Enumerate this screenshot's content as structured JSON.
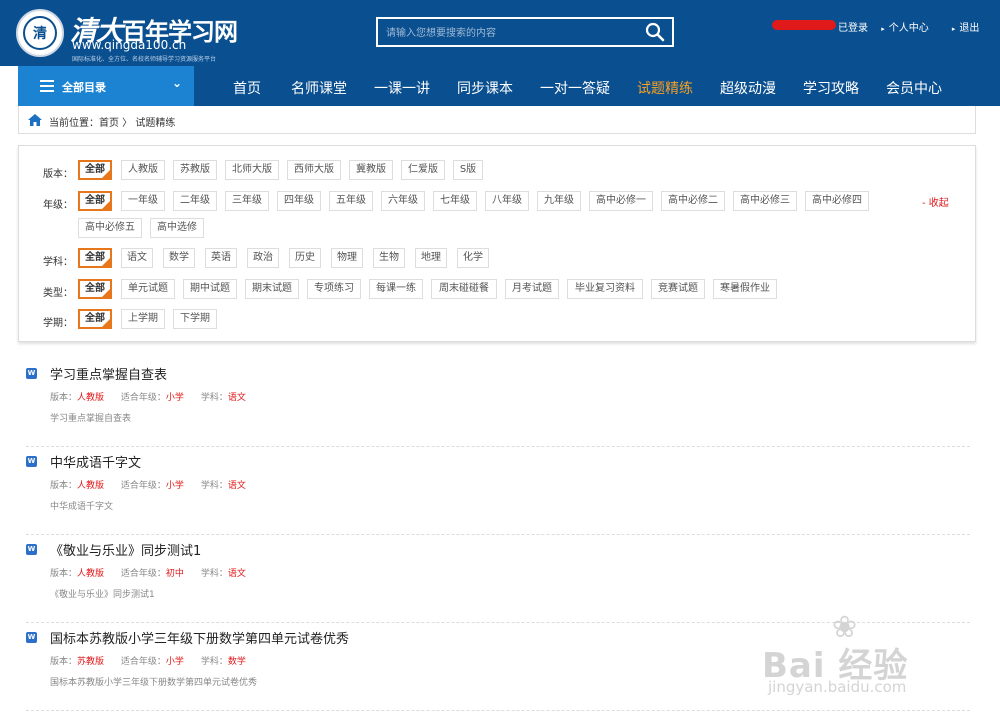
{
  "header": {
    "brand_seal": "清",
    "brand_name_part1": "清大",
    "brand_name_part2": "百年学习网",
    "brand_url": "www.qingda100.cn",
    "brand_slogan": "国际标准化、全方位、名校名师辅导学习资源服务平台",
    "search_placeholder": "请输入您想要搜索的内容",
    "user_links": {
      "login": "已登录",
      "personal": "个人中心",
      "logout": "退出"
    }
  },
  "nav": {
    "catalog": "全部目录",
    "items": [
      "首页",
      "名师课堂",
      "一课一讲",
      "同步课本",
      "一对一答疑",
      "试题精练",
      "超级动漫",
      "学习攻略",
      "会员中心"
    ],
    "active": "试题精练"
  },
  "breadcrumb": {
    "text": "当前位置：首页 〉 试题精练"
  },
  "filters": {
    "collapse_label": "- 收起",
    "rows": [
      {
        "label": "版本：",
        "options": [
          "全部",
          "人教版",
          "苏教版",
          "北师大版",
          "西师大版",
          "冀教版",
          "仁爱版",
          "S版"
        ]
      },
      {
        "label": "年级：",
        "options": [
          "全部",
          "一年级",
          "二年级",
          "三年级",
          "四年级",
          "五年级",
          "六年级",
          "七年级",
          "八年级",
          "九年级",
          "高中必修一",
          "高中必修二",
          "高中必修三",
          "高中必修四",
          "高中必修五",
          "高中选修"
        ]
      },
      {
        "label": "学科：",
        "options": [
          "全部",
          "语文",
          "数学",
          "英语",
          "政治",
          "历史",
          "物理",
          "生物",
          "地理",
          "化学"
        ]
      },
      {
        "label": "类型：",
        "options": [
          "全部",
          "单元试题",
          "期中试题",
          "期末试题",
          "专项练习",
          "每课一练",
          "周末碰碰餐",
          "月考试题",
          "毕业复习资料",
          "竞赛试题",
          "寒暑假作业"
        ]
      },
      {
        "label": "学期：",
        "options": [
          "全部",
          "上学期",
          "下学期"
        ]
      }
    ]
  },
  "results": {
    "meta_labels": {
      "edition": "版本：",
      "grade": "适合年级：",
      "subject": "学科："
    },
    "items": [
      {
        "title": "学习重点掌握自查表",
        "edition": "人教版",
        "grade": "小学",
        "subject": "语文",
        "desc": "学习重点掌握自查表"
      },
      {
        "title": "中华成语千字文",
        "edition": "人教版",
        "grade": "小学",
        "subject": "语文",
        "desc": "中华成语千字文"
      },
      {
        "title": "《敬业与乐业》同步测试1",
        "edition": "人教版",
        "grade": "初中",
        "subject": "语文",
        "desc": "《敬业与乐业》同步测试1"
      },
      {
        "title": "国标本苏教版小学三年级下册数学第四单元试卷优秀",
        "edition": "苏教版",
        "grade": "小学",
        "subject": "数学",
        "desc": "国标本苏教版小学三年级下册数学第四单元试卷优秀"
      }
    ]
  },
  "watermark": {
    "text": "Bai 经验",
    "url": "jingyan.baidu.com"
  }
}
